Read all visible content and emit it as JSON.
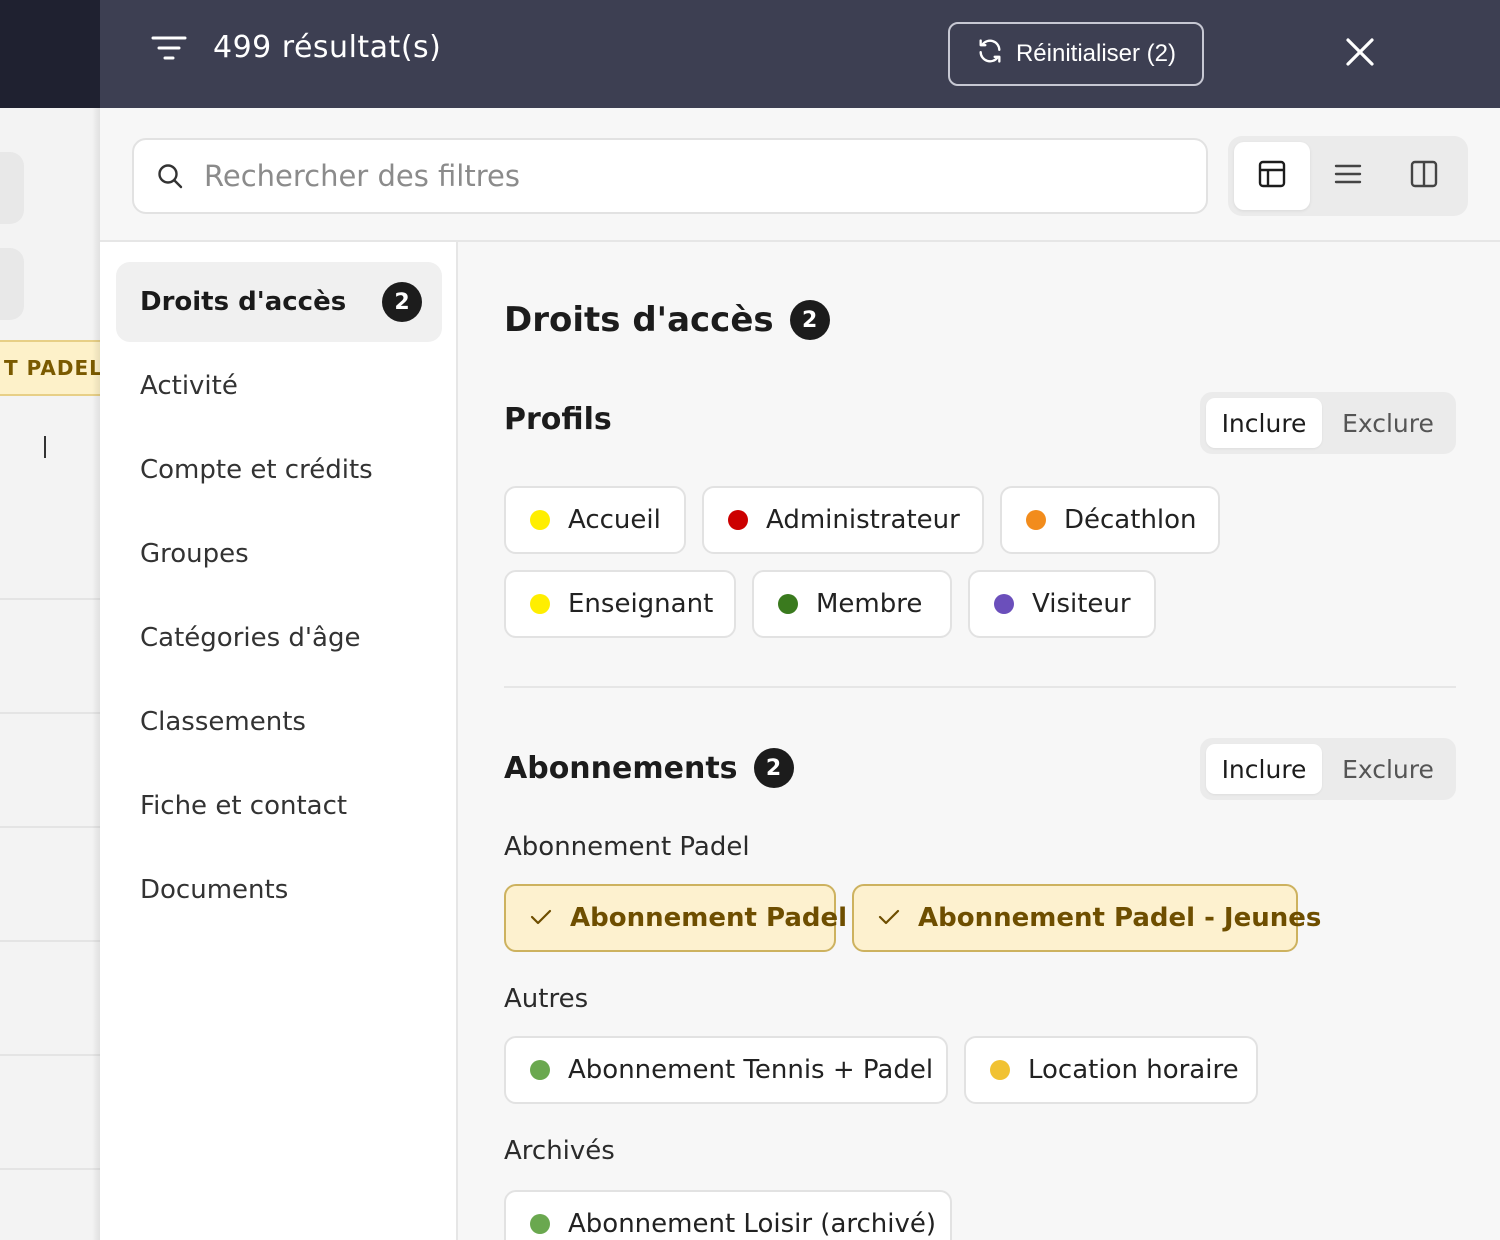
{
  "background_page": {
    "tag_text": "T PADEL -"
  },
  "topbar": {
    "result_count": "499 résultat(s)",
    "reset_label": "Réinitialiser (2)",
    "icons": [
      "filter-icon",
      "refresh-icon",
      "close-icon"
    ]
  },
  "search": {
    "placeholder": "Rechercher des filtres",
    "value": ""
  },
  "view_toggle": {
    "options": [
      "layout-icon",
      "list-icon",
      "columns-icon"
    ],
    "selected": "layout-icon"
  },
  "sidebar": {
    "items": [
      {
        "label": "Droits d'accès",
        "badge": "2",
        "active": true
      },
      {
        "label": "Activité"
      },
      {
        "label": "Compte et crédits"
      },
      {
        "label": "Groupes"
      },
      {
        "label": "Catégories d'âge"
      },
      {
        "label": "Classements"
      },
      {
        "label": "Fiche et contact"
      },
      {
        "label": "Documents"
      }
    ]
  },
  "main": {
    "title": "Droits d'accès",
    "title_badge": "2",
    "profils": {
      "title": "Profils",
      "include_label": "Inclure",
      "exclude_label": "Exclure",
      "mode": "Inclure",
      "chips": [
        {
          "label": "Accueil",
          "color": "#ffee00"
        },
        {
          "label": "Administrateur",
          "color": "#cc0000"
        },
        {
          "label": "Décathlon",
          "color": "#f28c1c"
        },
        {
          "label": "Enseignant",
          "color": "#ffee00"
        },
        {
          "label": "Membre",
          "color": "#3a7a1e"
        },
        {
          "label": "Visiteur",
          "color": "#6b4fbb"
        }
      ]
    },
    "abonnements": {
      "title": "Abonnements",
      "badge": "2",
      "include_label": "Inclure",
      "exclude_label": "Exclure",
      "mode": "Inclure",
      "groups": [
        {
          "label": "Abonnement Padel",
          "chips": [
            {
              "label": "Abonnement Padel",
              "selected": true
            },
            {
              "label": "Abonnement Padel - Jeunes",
              "selected": true
            }
          ]
        },
        {
          "label": "Autres",
          "chips": [
            {
              "label": "Abonnement Tennis + Padel",
              "color": "#6aa84f"
            },
            {
              "label": "Location horaire",
              "color": "#f1c232"
            }
          ]
        },
        {
          "label": "Archivés",
          "chips": [
            {
              "label": "Abonnement Loisir (archivé)",
              "color": "#6aa84f"
            }
          ]
        }
      ]
    }
  },
  "colors": {
    "topbar_bg": "#3d3f52",
    "selected_chip_bg": "#fdf1cf",
    "selected_chip_border": "#cdb25f",
    "selected_chip_text": "#6e4e00",
    "badge_bg": "#1c1c1c"
  }
}
